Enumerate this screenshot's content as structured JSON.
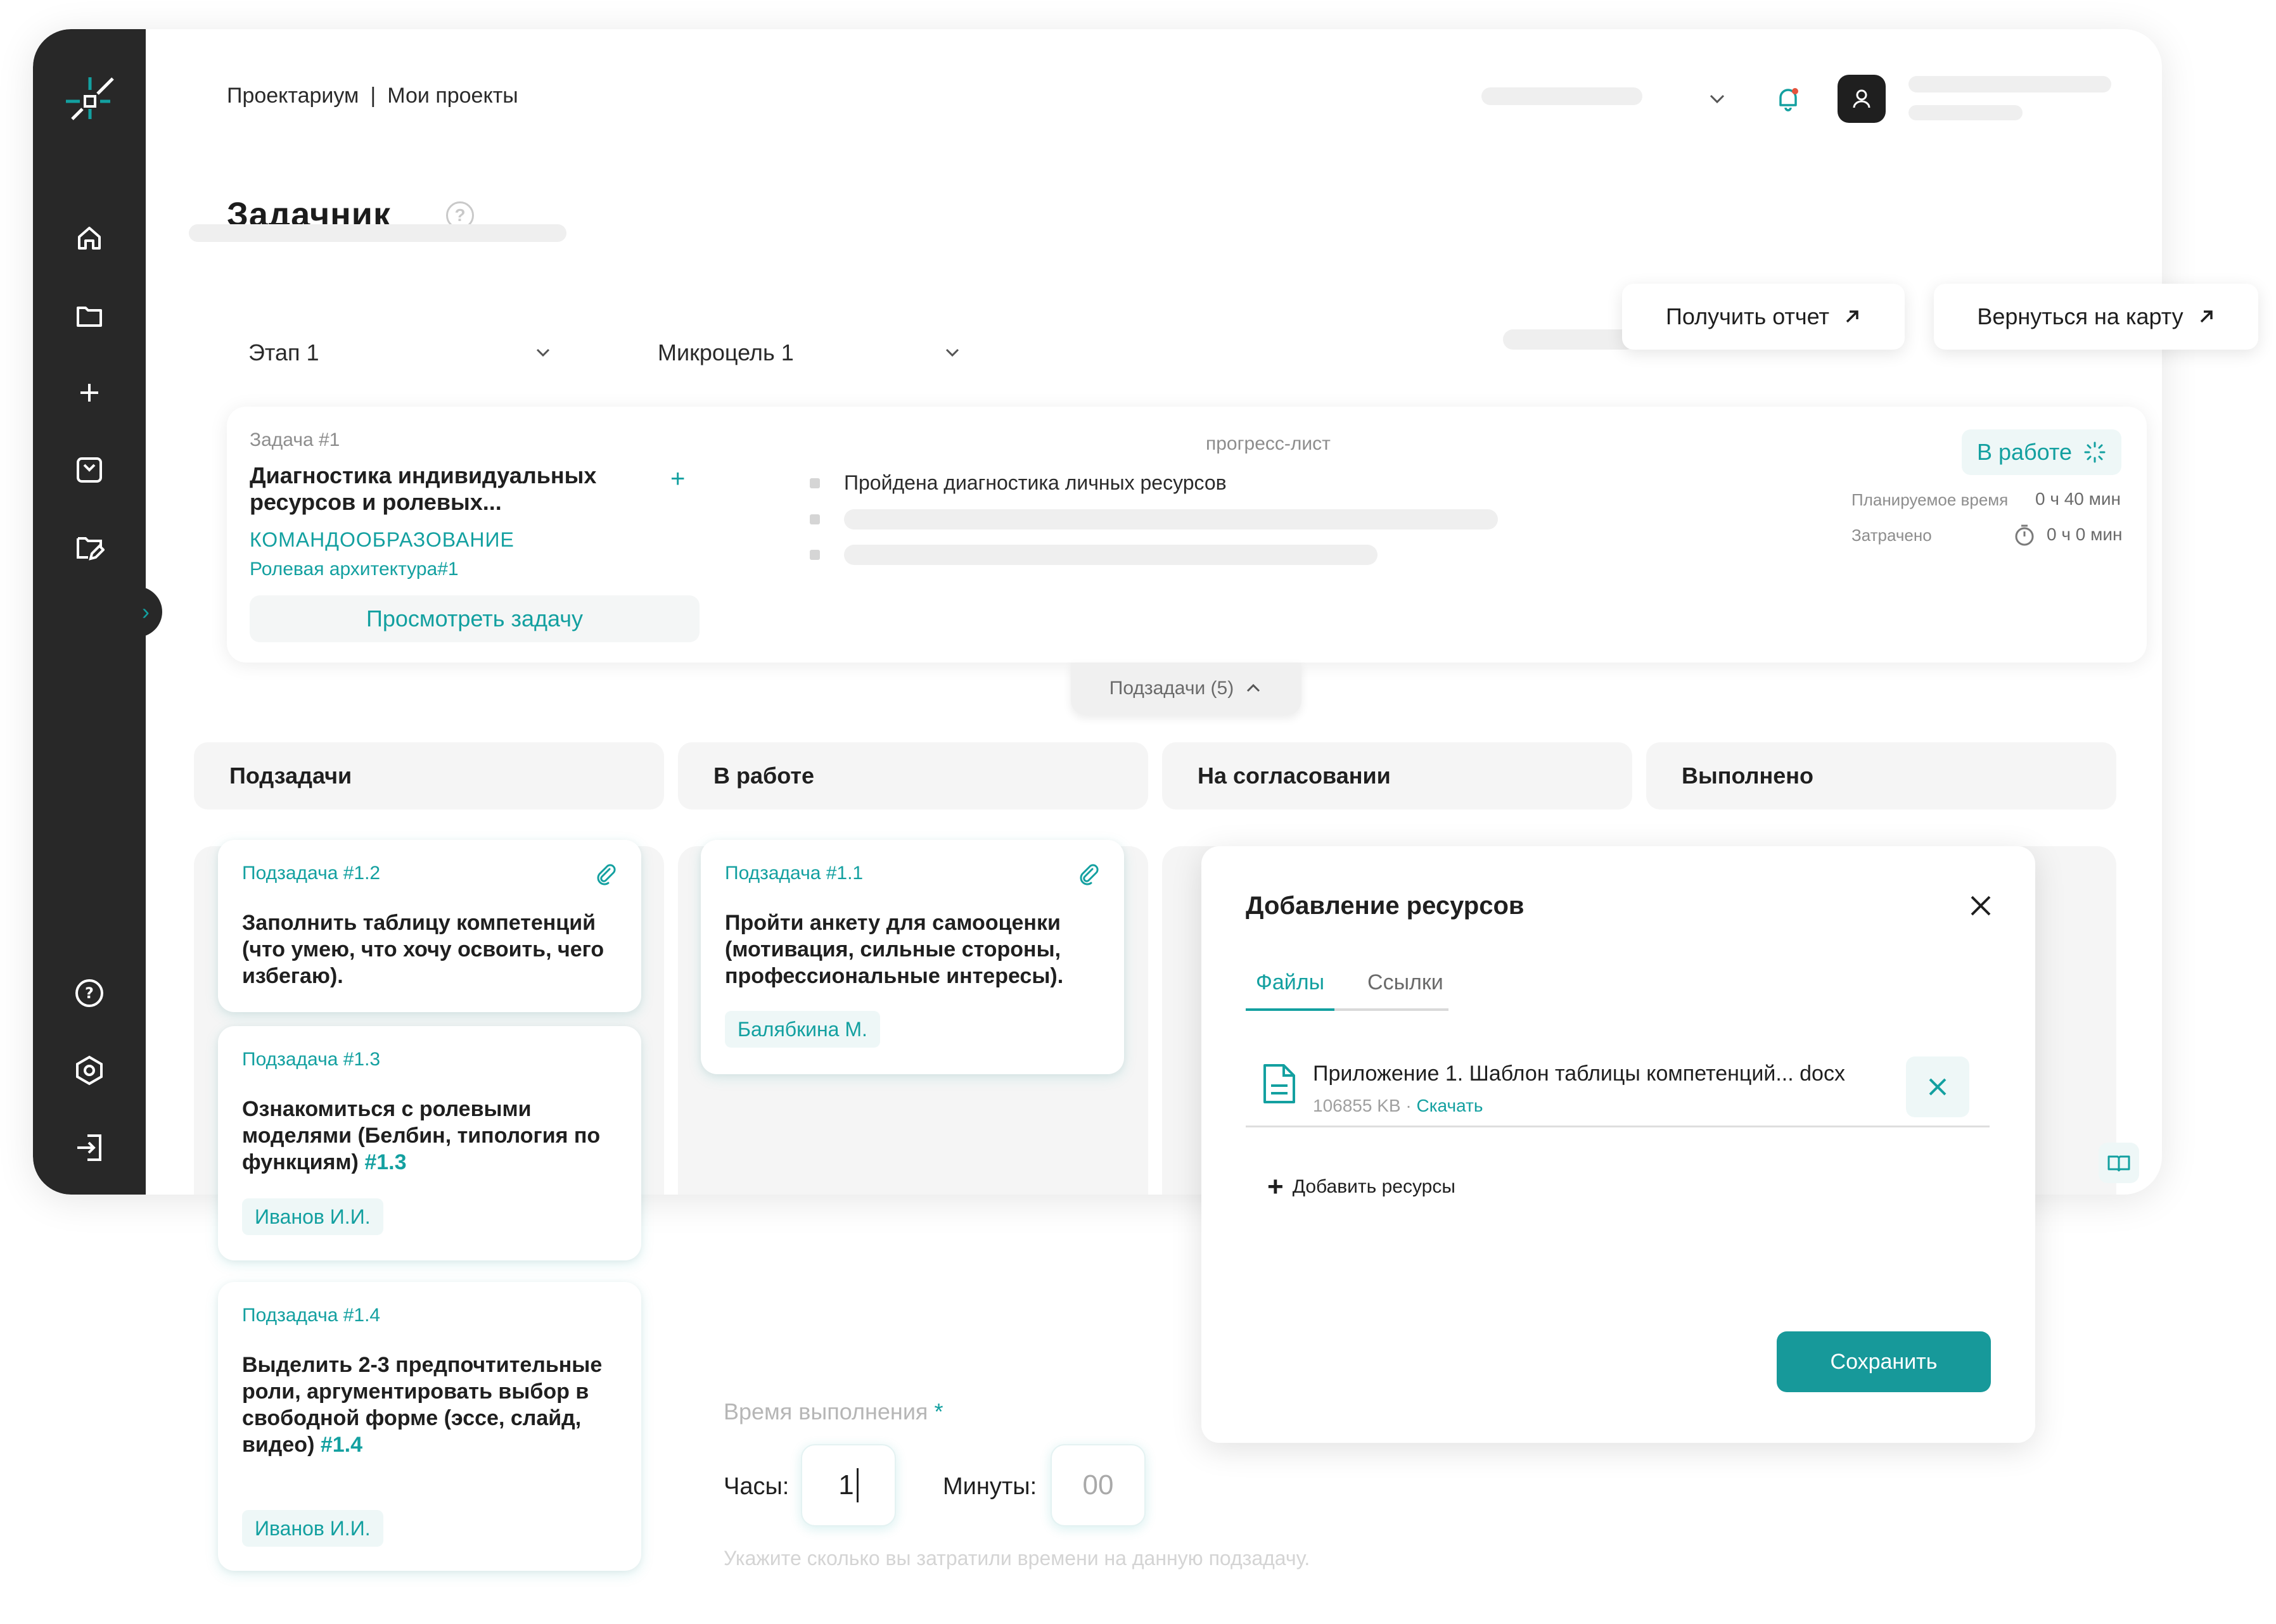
{
  "header": {
    "breadcrumb": [
      "Проектариум",
      "Мои проекты"
    ],
    "separator": "|",
    "page_title": "Задачник",
    "help_icon": "?"
  },
  "filters": {
    "stage": "Этап 1",
    "microgoal": "Микроцель 1"
  },
  "actions": {
    "report_label": "Получить отчет",
    "back_label": "Вернуться на карту"
  },
  "task": {
    "number": "Задача #1",
    "title": "Диагностика индивидуальных ресурсов и ролевых...",
    "category": "КОМАНДООБРАЗОВАНИЕ",
    "subcategory": "Ролевая архитектура#1",
    "view_label": "Просмотреть задачу",
    "add_icon": "+",
    "progress_title": "прогресс-лист",
    "progress_items": [
      "Пройдена диагностика личных ресурсов"
    ],
    "status": "В работе",
    "planned_label": "Планируемое время",
    "planned_value": "0 ч 40 мин",
    "spent_label": "Затрачено",
    "spent_value": "0 ч 0 мин",
    "subtasks_toggle": "Подзадачи (5)"
  },
  "columns": [
    "Подзадачи",
    "В работе",
    "На согласовании",
    "Выполнено"
  ],
  "subtasks": [
    {
      "number": "Подзадача #1.2",
      "title": "Заполнить таблицу компетенций (что умею, что хочу освоить, чего избегаю).",
      "ref": "",
      "assignee": ""
    },
    {
      "number": "Подзадача #1.3",
      "title": "Ознакомиться с ролевыми моделями (Белбин, типология по функциям)",
      "ref": "#1.3",
      "assignee": "Иванов И.И."
    },
    {
      "number": "Подзадача #1.4",
      "title": "Выделить 2-3 предпочтительные роли, аргументировать выбор в свободной форме (эссе, слайд, видео)",
      "ref": "#1.4",
      "assignee": "Иванов И.И."
    },
    {
      "number": "Подзадача #1.1",
      "title": "Пройти анкету для самооценки (мотивация, сильные стороны, профессиональные интересы).",
      "ref": "",
      "assignee": "Балябкина М."
    }
  ],
  "modal": {
    "title": "Добавление ресурсов",
    "tabs": [
      "Файлы",
      "Ссылки"
    ],
    "file_name": "Приложение 1. Шаблон таблицы компетенций... docx",
    "file_size": "106855 KB",
    "file_dot": "·",
    "file_download": "Скачать",
    "add_label": "Добавить ресурсы",
    "save_label": "Сохранить"
  },
  "time_form": {
    "label": "Время выполнения",
    "required_mark": "*",
    "hours_label": "Часы:",
    "hours_value": "1",
    "minutes_label": "Минуты:",
    "minutes_placeholder": "00",
    "hint": "Укажите сколько вы затратили времени на данную подзадачу."
  },
  "colors": {
    "accent": "#13a0a0",
    "sidebar": "#282828",
    "save_button": "#17999a"
  }
}
